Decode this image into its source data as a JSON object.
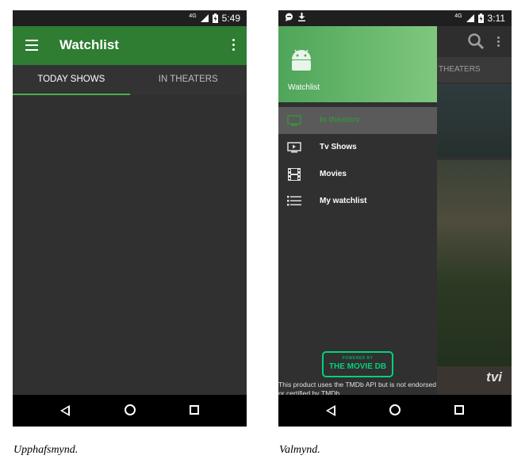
{
  "left_screen": {
    "status_bar": {
      "network": "4G",
      "time": "5:49"
    },
    "app_bar": {
      "title": "Watchlist",
      "menu_icon": "hamburger-icon",
      "overflow_icon": "more-vert-icon"
    },
    "tabs": [
      {
        "label": "TODAY SHOWS",
        "active": true
      },
      {
        "label": "IN THEATERS",
        "active": false
      }
    ],
    "colors": {
      "primary": "#2e7d32",
      "accent": "#4caf50",
      "background": "#303030"
    }
  },
  "right_screen": {
    "status_bar": {
      "network": "4G",
      "time": "3:11",
      "notification_icons": [
        "chat-icon",
        "download-icon"
      ]
    },
    "background_app": {
      "tab_label": "THEATERS",
      "logo_text": "tvi"
    },
    "drawer": {
      "header_title": "Watchlist",
      "items": [
        {
          "label": "In theaters",
          "icon": "theater-icon",
          "selected": true
        },
        {
          "label": "Tv Shows",
          "icon": "tv-icon",
          "selected": false
        },
        {
          "label": "Movies",
          "icon": "film-icon",
          "selected": false
        },
        {
          "label": "My watchlist",
          "icon": "list-icon",
          "selected": false
        }
      ],
      "tmdb_badge": {
        "top": "POWERED BY",
        "main": "THE MOVIE DB"
      },
      "footer": "This product uses the TMDb API but is not endorsed or certified by TMDb."
    }
  },
  "nav_bar": {
    "icons": [
      "back-icon",
      "home-icon",
      "recents-icon"
    ]
  },
  "captions": {
    "left": "Upphafsmynd.",
    "right": "Valmynd."
  }
}
